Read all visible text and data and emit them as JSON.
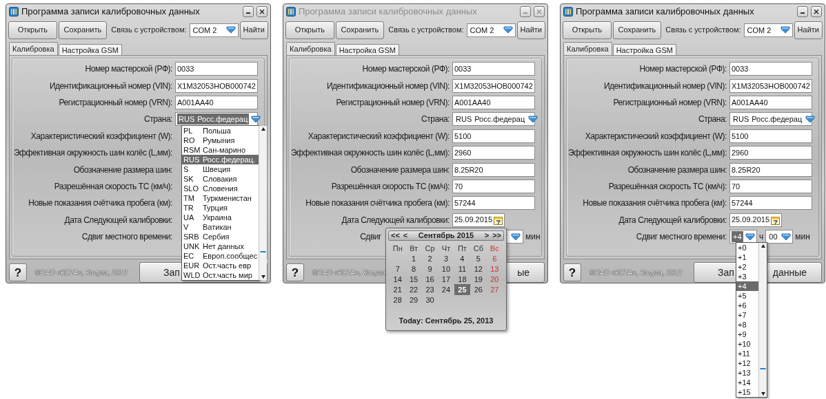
{
  "windows": [
    {
      "title": "Программа записи калибровочных данных",
      "active": true,
      "toolbar": {
        "buttons": [
          "Открыть",
          "Сохранить"
        ],
        "connection_label": "Связь с устройством:",
        "port": "COM 2",
        "find": "Найти"
      },
      "tabs": [
        {
          "label": "Калибровка",
          "selected": true
        },
        {
          "label": "Настройка GSM",
          "selected": false
        }
      ],
      "fields": [
        {
          "kind": "text",
          "label": "Номер мастерской (РФ):",
          "value": "0033"
        },
        {
          "kind": "text",
          "label": "Идентификационный номер (VIN):",
          "value": "X1M32053HOB000742"
        },
        {
          "kind": "text",
          "label": "Регистрационный номер (VRN):",
          "value": "A001AA40"
        },
        {
          "kind": "select",
          "label": "Страна:",
          "code": "RUS",
          "value": "Росс.федерац",
          "focused": true
        },
        {
          "kind": "text",
          "label": "Характеристический коэффициент (W):"
        },
        {
          "kind": "text",
          "label": "Эффективная окружность шин колёс (L,мм):"
        },
        {
          "kind": "text",
          "label": "Обозначение размера шин:"
        },
        {
          "kind": "text",
          "label": "Разрешённая скорость ТС (км/ч):"
        },
        {
          "kind": "text",
          "label": "Новые показания счётчика пробега (км):"
        },
        {
          "kind": "date",
          "label": "Дата Следующей калибровки:"
        },
        {
          "kind": "offset",
          "label": "Сдвиг местного времени:"
        }
      ],
      "footer": {
        "help": "?",
        "copyright": "©ОАО «КСТА», Калуга, 2012",
        "write_left": "Зап"
      },
      "popup": {
        "kind": "country_list",
        "items": [
          {
            "code": "PL",
            "name": "Польша",
            "selected": false
          },
          {
            "code": "RO",
            "name": "Румыния",
            "selected": false
          },
          {
            "code": "RSM",
            "name": "Сан-марино",
            "selected": false
          },
          {
            "code": "RUS",
            "name": "Росс.федерац.",
            "selected": true
          },
          {
            "code": "S",
            "name": "Швеция",
            "selected": false
          },
          {
            "code": "SK",
            "name": "Словакия",
            "selected": false
          },
          {
            "code": "SLO",
            "name": "Словения",
            "selected": false
          },
          {
            "code": "TM",
            "name": "Туркменистан",
            "selected": false
          },
          {
            "code": "TR",
            "name": "Турция",
            "selected": false
          },
          {
            "code": "UA",
            "name": "Украина",
            "selected": false
          },
          {
            "code": "V",
            "name": "Ватикан",
            "selected": false
          },
          {
            "code": "SRB",
            "name": "Сербия",
            "selected": false
          },
          {
            "code": "UNK",
            "name": "Нет данных",
            "selected": false
          },
          {
            "code": "EC",
            "name": "Европ.сообщес",
            "selected": false
          },
          {
            "code": "EUR",
            "name": "Ост.часть евр",
            "selected": false
          },
          {
            "code": "WLD",
            "name": "Ост.часть мир",
            "selected": false
          }
        ]
      }
    },
    {
      "title": "Программа записи калибровочных данных",
      "active": false,
      "toolbar": {
        "buttons": [
          "Открыть",
          "Сохранить"
        ],
        "connection_label": "Связь с устройством:",
        "port": "COM 2",
        "find": "Найти"
      },
      "tabs": [
        {
          "label": "Калибровка",
          "selected": true
        },
        {
          "label": "Настройка GSM",
          "selected": false
        }
      ],
      "fields": [
        {
          "kind": "text",
          "label": "Номер мастерской (РФ):",
          "value": "0033"
        },
        {
          "kind": "text",
          "label": "Идентификационный номер (VIN):",
          "value": "X1M32053HOB000742"
        },
        {
          "kind": "text",
          "label": "Регистрационный номер (VRN):",
          "value": "A001AA40"
        },
        {
          "kind": "select",
          "label": "Страна:",
          "code": "RUS",
          "value": "Росс.федерац",
          "focused": false
        },
        {
          "kind": "text",
          "label": "Характеристический коэффициент (W):",
          "value": "5100"
        },
        {
          "kind": "text",
          "label": "Эффективная окружность шин колёс (L,мм):",
          "value": "2960"
        },
        {
          "kind": "text",
          "label": "Обозначение размера шин:",
          "value": "8.25R20"
        },
        {
          "kind": "text",
          "label": "Разрешённая скорость ТС (км/ч):",
          "value": "70"
        },
        {
          "kind": "text",
          "label": "Новые показания счётчика пробега (км):",
          "value": "57244"
        },
        {
          "kind": "date",
          "label": "Дата Следующей калибровки:",
          "value": "25.09.2015"
        },
        {
          "kind": "offset",
          "label": "Сдвиг",
          "minutes_unit": "мин"
        }
      ],
      "footer": {
        "help": "?",
        "copyright": "©ОАО «КСТА», Калуга",
        "write_right": "ые"
      },
      "popup": {
        "kind": "calendar",
        "nav_back": [
          "<<",
          "<"
        ],
        "month": "Сентябрь 2015",
        "nav_forward": [
          ">",
          ">>"
        ],
        "weekdays": [
          {
            "text": "Пн",
            "weekend": false
          },
          {
            "text": "Вт",
            "weekend": false
          },
          {
            "text": "Ср",
            "weekend": false
          },
          {
            "text": "Чт",
            "weekend": false
          },
          {
            "text": "Пт",
            "weekend": false
          },
          {
            "text": "Сб",
            "weekend": false
          },
          {
            "text": "Вс",
            "weekend": true
          }
        ],
        "weeks": [
          [
            {
              "text": "1",
              "weekend": false,
              "selected": false
            },
            {
              "text": "2",
              "weekend": false,
              "selected": false
            },
            {
              "text": "3",
              "weekend": false,
              "selected": false
            },
            {
              "text": "4",
              "weekend": false,
              "selected": false
            },
            {
              "text": "5",
              "weekend": false,
              "selected": false
            },
            {
              "text": "6",
              "weekend": true,
              "selected": false
            }
          ],
          [
            {
              "text": "7",
              "weekend": false,
              "selected": false
            },
            {
              "text": "8",
              "weekend": false,
              "selected": false
            },
            {
              "text": "9",
              "weekend": false,
              "selected": false
            },
            {
              "text": "10",
              "weekend": false,
              "selected": false
            },
            {
              "text": "11",
              "weekend": false,
              "selected": false
            },
            {
              "text": "12",
              "weekend": false,
              "selected": false
            },
            {
              "text": "13",
              "weekend": true,
              "selected": false
            }
          ],
          [
            {
              "text": "14",
              "weekend": false,
              "selected": false
            },
            {
              "text": "15",
              "weekend": false,
              "selected": false
            },
            {
              "text": "16",
              "weekend": false,
              "selected": false
            },
            {
              "text": "17",
              "weekend": false,
              "selected": false
            },
            {
              "text": "18",
              "weekend": false,
              "selected": false
            },
            {
              "text": "19",
              "weekend": false,
              "selected": false
            },
            {
              "text": "20",
              "weekend": true,
              "selected": false
            }
          ],
          [
            {
              "text": "21",
              "weekend": false,
              "selected": false
            },
            {
              "text": "22",
              "weekend": false,
              "selected": false
            },
            {
              "text": "23",
              "weekend": false,
              "selected": false
            },
            {
              "text": "24",
              "weekend": false,
              "selected": false
            },
            {
              "text": "25",
              "weekend": false,
              "selected": true
            },
            {
              "text": "26",
              "weekend": false,
              "selected": false
            },
            {
              "text": "27",
              "weekend": true,
              "selected": false
            }
          ],
          [
            {
              "text": "28",
              "weekend": false,
              "selected": false
            },
            {
              "text": "29",
              "weekend": false,
              "selected": false
            },
            {
              "text": "30",
              "weekend": false,
              "selected": false
            }
          ]
        ],
        "today": "Today: Сентябрь 25, 2013"
      }
    },
    {
      "title": "Программа записи калибровочных данных",
      "active": true,
      "toolbar": {
        "buttons": [
          "Открыть",
          "Сохранить"
        ],
        "connection_label": "Связь с устройством:",
        "port": "COM 2",
        "find": "Найти"
      },
      "tabs": [
        {
          "label": "Калибровка",
          "selected": true
        },
        {
          "label": "Настройка GSM",
          "selected": false
        }
      ],
      "fields": [
        {
          "kind": "text",
          "label": "Номер мастерской (РФ):",
          "value": "0033"
        },
        {
          "kind": "text",
          "label": "Идентификационный номер (VIN):",
          "value": "X1M32053HOB000742"
        },
        {
          "kind": "text",
          "label": "Регистрационный номер (VRN):",
          "value": "A001AA40"
        },
        {
          "kind": "select",
          "label": "Страна:",
          "code": "RUS",
          "value": "Росс.федерац",
          "focused": false
        },
        {
          "kind": "text",
          "label": "Характеристический коэффициент (W):",
          "value": "5100"
        },
        {
          "kind": "text",
          "label": "Эффективная окружность шин колёс (L,мм):",
          "value": "2960"
        },
        {
          "kind": "text",
          "label": "Обозначение размера шин:",
          "value": "8.25R20"
        },
        {
          "kind": "text",
          "label": "Разрешённая скорость ТС (км/ч):",
          "value": "70"
        },
        {
          "kind": "text",
          "label": "Новые показания счётчика пробега (км):",
          "value": "57244"
        },
        {
          "kind": "date",
          "label": "Дата Следующей калибровки:",
          "value": "25.09.2015"
        },
        {
          "kind": "offset",
          "label": "Сдвиг местного времени:",
          "hours": "+4",
          "hours_focused": true,
          "hours_unit": "ч",
          "minutes": "00",
          "minutes_unit": "мин"
        }
      ],
      "footer": {
        "help": "?",
        "copyright": "©ОАО «КСТА», Калуга, 2012",
        "write_left": "Зап",
        "write_right": "данные"
      },
      "popup": {
        "kind": "hours_list",
        "items": [
          {
            "name": "+0",
            "selected": false
          },
          {
            "name": "+1",
            "selected": false
          },
          {
            "name": "+2",
            "selected": false
          },
          {
            "name": "+3",
            "selected": false
          },
          {
            "name": "+4",
            "selected": true
          },
          {
            "name": "+5",
            "selected": false
          },
          {
            "name": "+6",
            "selected": false
          },
          {
            "name": "+7",
            "selected": false
          },
          {
            "name": "+8",
            "selected": false
          },
          {
            "name": "+9",
            "selected": false
          },
          {
            "name": "+10",
            "selected": false
          },
          {
            "name": "+11",
            "selected": false
          },
          {
            "name": "+12",
            "selected": false
          },
          {
            "name": "+13",
            "selected": false
          },
          {
            "name": "+14",
            "selected": false
          },
          {
            "name": "+15",
            "selected": false
          }
        ]
      }
    }
  ]
}
